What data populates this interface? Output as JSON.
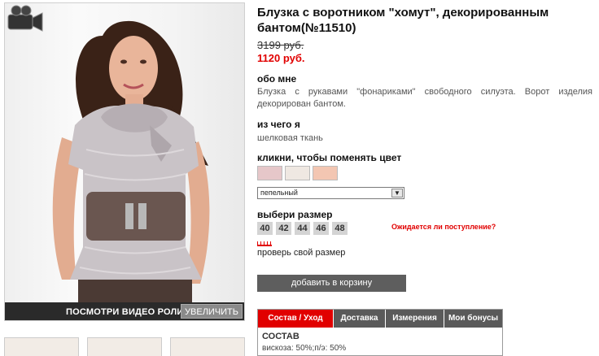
{
  "product": {
    "title": "Блузка с воротником \"хомут\", декорированным бантом(№11510)",
    "old_price": "3199 руб.",
    "new_price": "1120 руб."
  },
  "about": {
    "heading": "обо мне",
    "text": "Блузка с рукавами \"фонариками\" свободного силуэта. Ворот изделия декорирован бантом."
  },
  "material": {
    "heading": "из чего я",
    "text": "шелковая ткань"
  },
  "color": {
    "heading": "кликни, чтобы поменять цвет",
    "swatches": [
      "#e6c7c9",
      "#efe8e2",
      "#f3c6b2"
    ],
    "selected": "пепельный"
  },
  "size": {
    "heading": "выбери размер",
    "options": [
      "40",
      "42",
      "44",
      "46",
      "48"
    ],
    "awaiting_link": "Ожидается ли поступление?",
    "check_link": "проверь свой размер"
  },
  "cart_button": "добавить в корзину",
  "media": {
    "video_label": "ПОСМОТРИ ВИДЕО РОЛИК",
    "zoom_label": "УВЕЛИЧИТЬ"
  },
  "tabs": {
    "items": [
      "Состав / Уход",
      "Доставка",
      "Измерения",
      "Мои бонусы"
    ],
    "active_heading": "СОСТАВ",
    "active_text": "вискоза: 50%;п/э: 50%"
  },
  "colors": {
    "accent": "#e10000",
    "button": "#5e5e5e"
  }
}
